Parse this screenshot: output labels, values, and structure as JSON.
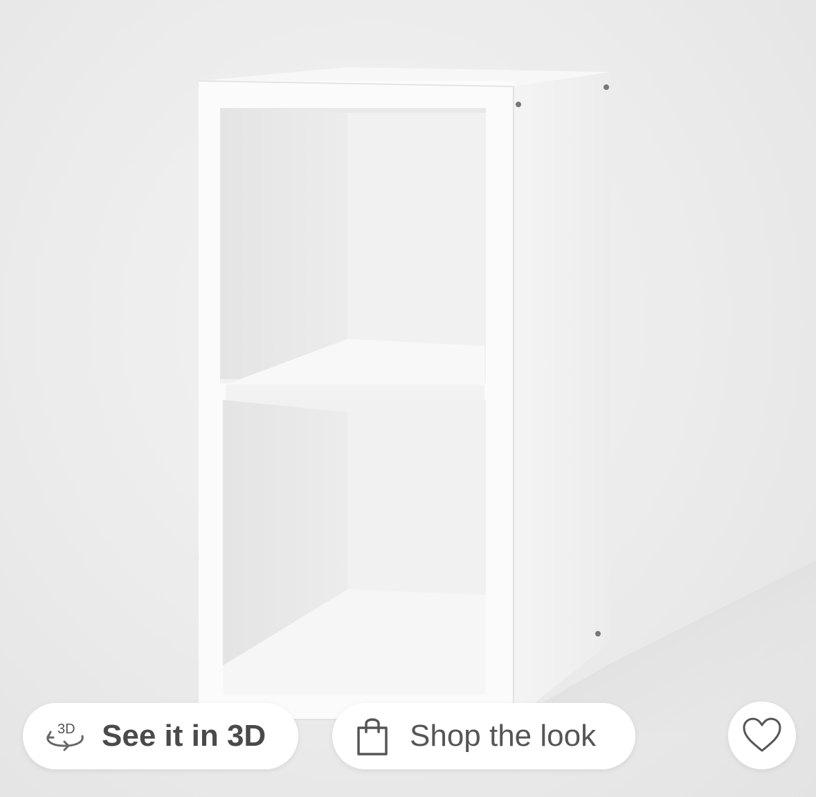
{
  "product": {
    "image_alt": "White 2-cube organizer shelf"
  },
  "actions": {
    "view_3d_label": "See it in 3D",
    "view_3d_icon": "3d-rotate-icon",
    "view_3d_icon_text": "3D",
    "shop_look_label": "Shop the look",
    "shop_look_icon": "shopping-bag-icon",
    "favorite_icon": "heart-icon"
  },
  "colors": {
    "background": "#eeeeee",
    "pill_background": "#ffffff",
    "label_text": "#4a4a4a",
    "icon_stroke": "#666666"
  }
}
